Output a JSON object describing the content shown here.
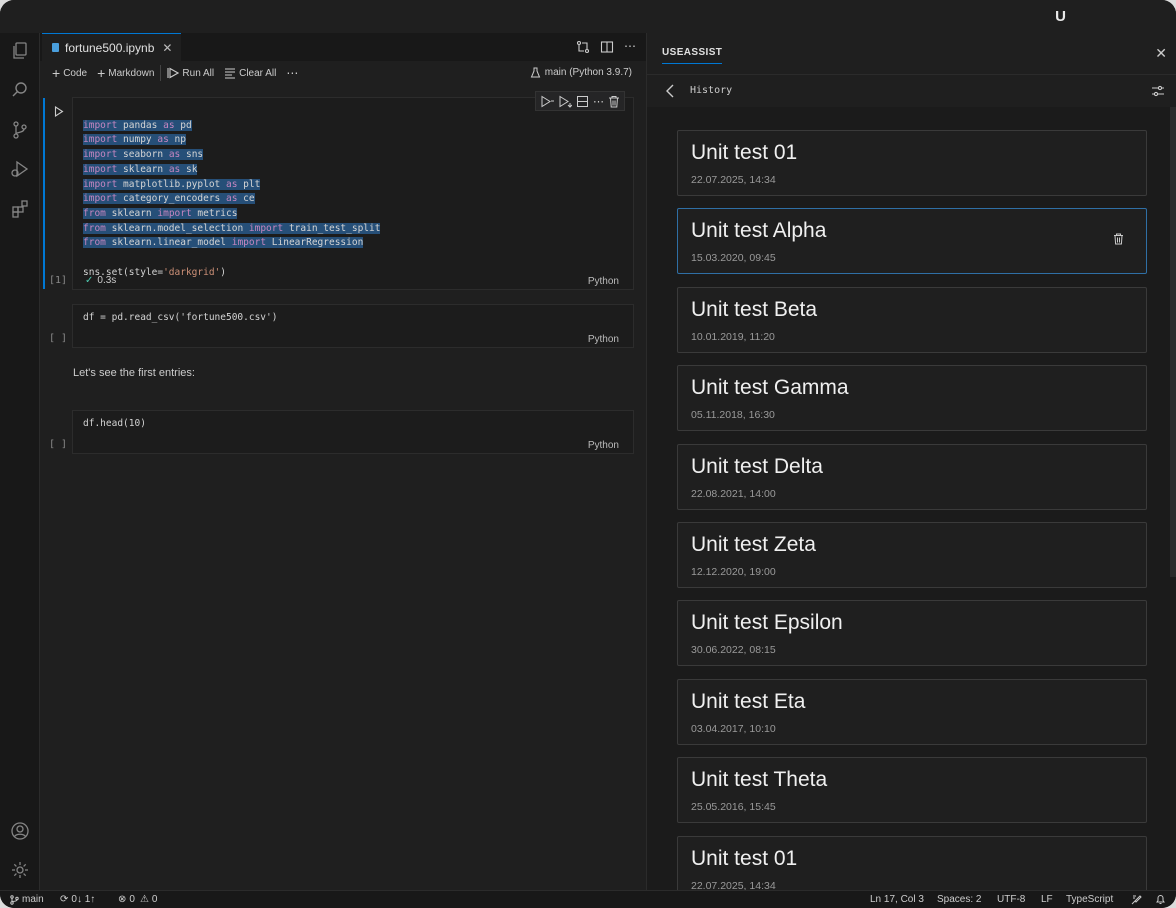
{
  "brand": {
    "logo_letter": "U"
  },
  "editor": {
    "tab": {
      "filename": "fortune500.ipynb",
      "close": "✕"
    },
    "toolbar": {
      "add_code": "Code",
      "add_markdown": "Markdown",
      "run_all": "Run All",
      "clear_all": "Clear All",
      "more": "⋯",
      "kernel": "main (Python 3.9.7)"
    },
    "cells": [
      {
        "exec": "[1]",
        "lang": "Python",
        "status": "0.3s"
      },
      {
        "exec": "[ ]",
        "lang": "Python",
        "code": "df = pd.read_csv('fortune500.csv')"
      },
      {
        "markdown": "Let's see the first entries:"
      },
      {
        "exec": "[ ]",
        "lang": "Python",
        "code": "df.head(10)"
      }
    ]
  },
  "panel": {
    "title": "USEASSIST",
    "history_label": "History",
    "items": [
      {
        "title": "Unit test 01",
        "date": "22.07.2025, 14:34"
      },
      {
        "title": "Unit test Alpha",
        "date": "15.03.2020, 09:45"
      },
      {
        "title": "Unit test Beta",
        "date": "10.01.2019, 11:20"
      },
      {
        "title": "Unit test Gamma",
        "date": "05.11.2018, 16:30"
      },
      {
        "title": "Unit test Delta",
        "date": "22.08.2021, 14:00"
      },
      {
        "title": "Unit test Zeta",
        "date": "12.12.2020, 19:00"
      },
      {
        "title": "Unit test Epsilon",
        "date": "30.06.2022, 08:15"
      },
      {
        "title": "Unit test Eta",
        "date": "03.04.2017, 10:10"
      },
      {
        "title": "Unit test Theta",
        "date": "25.05.2016, 15:45"
      },
      {
        "title": "Unit test 01",
        "date": "22.07.2025, 14:34"
      }
    ]
  },
  "status": {
    "branch": "main",
    "sync": "0↓ 1↑",
    "errors": "0",
    "warnings": "0",
    "position": "Ln 17, Col 3",
    "spaces": "Spaces: 2",
    "encoding": "UTF-8",
    "eol": "LF",
    "language": "TypeScript"
  }
}
